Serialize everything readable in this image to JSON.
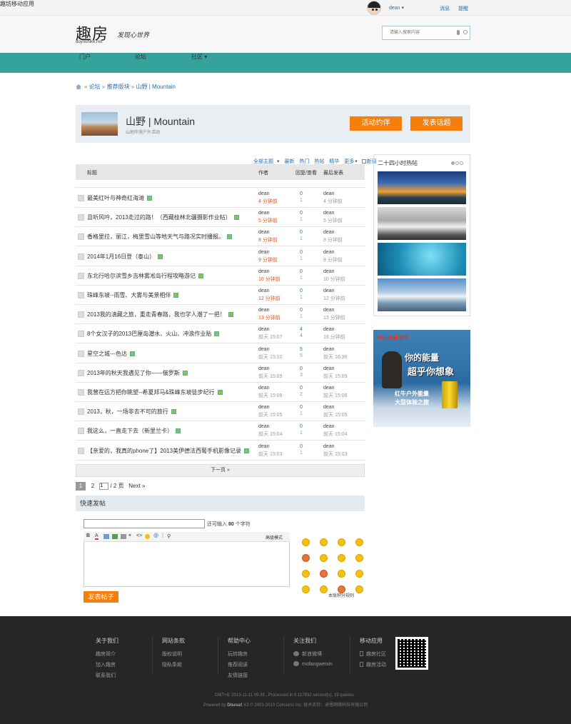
{
  "topbar": {
    "app_link": "趣坊移动应用",
    "username": "dean",
    "messages": "消息",
    "reminders": "提醒"
  },
  "header": {
    "logo": "趣房",
    "logo_sub": "doyouhike.net",
    "slogan": "发现心世界",
    "search_placeholder": "请输入搜索内容"
  },
  "nav": {
    "items": [
      "门户",
      "论坛",
      "社区"
    ],
    "active": "论坛"
  },
  "breadcrumb": {
    "items": [
      "论坛",
      "推荐版块",
      "山野 | Mountain"
    ],
    "sep": "»"
  },
  "forum": {
    "title": "山野 | Mountain",
    "desc": "山地环境户外活动",
    "btn_event": "活动约伴",
    "btn_post": "发表话题"
  },
  "filters": [
    "全部主题",
    "最新",
    "热门",
    "热帖",
    "精华",
    "更多",
    "新窗"
  ],
  "table": {
    "headers": {
      "title": "标题",
      "author": "作者",
      "replies": "回复/查看",
      "last": "最后发表"
    },
    "rows": [
      {
        "title": "最美红叶与神奇红海滩",
        "author": "dean",
        "time": "4 分钟前",
        "replies": "0",
        "views": "1",
        "last_user": "dean",
        "last_time": "4 分钟前",
        "recent": true
      },
      {
        "title": "且听风吟，2013走过的路！（西藏桂林北疆摄影作业帖）",
        "author": "dean",
        "time": "5 分钟前",
        "replies": "0",
        "views": "1",
        "last_user": "dean",
        "last_time": "5 分钟前",
        "recent": true
      },
      {
        "title": "香格里拉，丽江，梅里雪山等地天气与路况实时播报。",
        "author": "dean",
        "time": "8 分钟前",
        "replies": "0",
        "views": "1",
        "last_user": "dean",
        "last_time": "8 分钟前",
        "recent": true
      },
      {
        "title": "2014年1月16日登（泰山）",
        "author": "dean",
        "time": "9 分钟前",
        "replies": "0",
        "views": "1",
        "last_user": "dean",
        "last_time": "9 分钟前",
        "recent": true
      },
      {
        "title": "东北行哈尔滨雪乡吉林雾凇岛行程攻略游记",
        "author": "dean",
        "time": "10 分钟前",
        "replies": "0",
        "views": "1",
        "last_user": "dean",
        "last_time": "10 分钟前",
        "recent": true
      },
      {
        "title": "珠峰东坡--雨雪、大雾与美景相伴",
        "author": "dean",
        "time": "12 分钟前",
        "replies": "0",
        "views": "1",
        "last_user": "dean",
        "last_time": "12 分钟前",
        "recent": true
      },
      {
        "title": "2013我的滇藏之旅，重走青春路，我也学人潮了一把！",
        "author": "dean",
        "time": "13 分钟前",
        "replies": "0",
        "views": "1",
        "last_user": "dean",
        "last_time": "13 分钟前",
        "recent": true
      },
      {
        "title": "8个女汉子的2013巴厘岛潜水、火山、冲浪作业贴",
        "author": "dean",
        "time": "前天 15:07",
        "replies": "4",
        "views": "4",
        "last_user": "dean",
        "last_time": "16 分钟前",
        "recent": false
      },
      {
        "title": "星空之城---色达",
        "author": "dean",
        "time": "前天 15:10",
        "replies": "5",
        "views": "5",
        "last_user": "dean",
        "last_time": "前天 16:36",
        "recent": false
      },
      {
        "title": "2013年的秋天我遇见了你——俄罗斯",
        "author": "dean",
        "time": "前天 15:09",
        "replies": "0",
        "views": "3",
        "last_user": "dean",
        "last_time": "前天 15:09",
        "recent": false
      },
      {
        "title": "我曾在远方把你眺望--希夏邦马&珠峰东坡徒步纪行",
        "author": "dean",
        "time": "前天 15:08",
        "replies": "0",
        "views": "2",
        "last_user": "dean",
        "last_time": "前天 15:08",
        "recent": false
      },
      {
        "title": "2013，秋，一场非去不可的旅行",
        "author": "dean",
        "time": "前天 15:05",
        "replies": "0",
        "views": "1",
        "last_user": "dean",
        "last_time": "前天 15:05",
        "recent": false
      },
      {
        "title": "我这么，一直走下去（新里兰卡）",
        "author": "dean",
        "time": "前天 15:04",
        "replies": "0",
        "views": "1",
        "last_user": "dean",
        "last_time": "前天 15:04",
        "recent": false
      },
      {
        "title": "【亲爱的，我真的phone了】2013美伊德法西葡手机影像记录",
        "author": "dean",
        "time": "前天 15:03",
        "replies": "0",
        "views": "1",
        "last_user": "dean",
        "last_time": "前天 15:03",
        "recent": false
      }
    ]
  },
  "next_page": "下一页 »",
  "pager": {
    "current": "1",
    "page2": "2",
    "input": "1",
    "total": "/ 2 页",
    "next": "Next »"
  },
  "quickpost": {
    "title": "快速发帖",
    "remain_pre": "还可输入",
    "remain_num": "80",
    "remain_post": "个字符",
    "advanced": "高级模式",
    "submit": "发表帖子",
    "rule": "本版积分规则"
  },
  "sidebar": {
    "hot_title": "二十四小时热帖"
  },
  "ad": {
    "brand": "Red Bull 红牛",
    "line1": "你的能量",
    "line2": "超乎你想象",
    "line3": "红牛户外能量",
    "line4": "大型体验之旅"
  },
  "footer": {
    "cols": [
      {
        "title": "关于我们",
        "items": [
          "趣房简介",
          "加入趣房",
          "联系我们"
        ]
      },
      {
        "title": "网站条款",
        "items": [
          "版权说明",
          "隐私条款"
        ]
      },
      {
        "title": "帮助中心",
        "items": [
          "玩转趣房",
          "推荐阅读",
          "友情链接"
        ]
      },
      {
        "title": "关注我们",
        "items": [
          "新浪微博",
          "mofangweixin"
        ]
      },
      {
        "title": "移动应用",
        "items": [
          "趣房社区",
          "趣房活动"
        ]
      }
    ],
    "line1": "GMT+8, 2013-11-11 09:39 , Processed in 0.117832 second(s), 19 queries .",
    "line2_pre": "Powered by",
    "line2_brand": "Discuz!",
    "line2_post": "X3 © 2001-2013 Comsenz Inc. 技术支持：迪恩网络科技有限公司"
  },
  "colors": {
    "nav": "#35a39c",
    "nav_active": "#1f7f78",
    "orange": "#f57f0a",
    "link": "#2b6fa8"
  }
}
